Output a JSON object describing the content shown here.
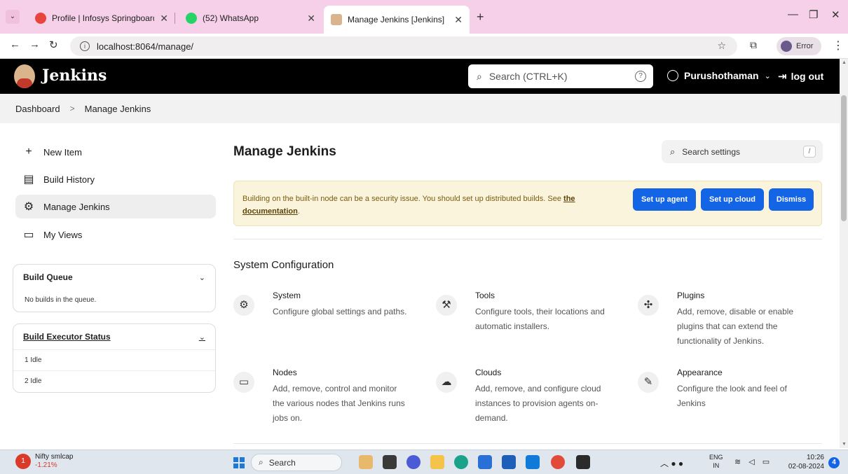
{
  "browser": {
    "tabs": [
      {
        "title": "Profile | Infosys Springboard",
        "active": false,
        "color": "#e8453c"
      },
      {
        "title": "(52) WhatsApp",
        "active": false,
        "color": "#25d366"
      },
      {
        "title": "Manage Jenkins [Jenkins]",
        "active": true,
        "color": "#d9b48c"
      }
    ],
    "url": "localhost:8064/manage/",
    "profile_label": "Error"
  },
  "header": {
    "brand": "Jenkins",
    "search_placeholder": "Search (CTRL+K)",
    "user": "Purushothaman",
    "logout": "log out"
  },
  "breadcrumb": {
    "items": [
      "Dashboard",
      "Manage Jenkins"
    ]
  },
  "sidebar": {
    "items": [
      {
        "label": "New Item",
        "icon": "plus-icon"
      },
      {
        "label": "Build History",
        "icon": "history-icon"
      },
      {
        "label": "Manage Jenkins",
        "icon": "gear-icon",
        "active": true
      },
      {
        "label": "My Views",
        "icon": "window-icon"
      }
    ],
    "build_queue": {
      "title": "Build Queue",
      "empty_text": "No builds in the queue."
    },
    "executor_status": {
      "title": "Build Executor Status",
      "rows": [
        "1  Idle",
        "2  Idle"
      ]
    }
  },
  "main": {
    "title": "Manage Jenkins",
    "settings_search_placeholder": "Search settings",
    "settings_search_shortcut": "/",
    "alert": {
      "text": "Building on the built-in node can be a security issue. You should set up distributed builds. See ",
      "link": "the documentation",
      "suffix": ".",
      "buttons": [
        "Set up agent",
        "Set up cloud",
        "Dismiss"
      ]
    },
    "section_title": "System Configuration",
    "cards": [
      {
        "title": "System",
        "desc": "Configure global settings and paths.",
        "icon": "gear-icon"
      },
      {
        "title": "Tools",
        "desc": "Configure tools, their locations and automatic installers.",
        "icon": "hammer-icon"
      },
      {
        "title": "Plugins",
        "desc": "Add, remove, disable or enable plugins that can extend the functionality of Jenkins.",
        "icon": "puzzle-icon"
      },
      {
        "title": "Nodes",
        "desc": "Add, remove, control and monitor the various nodes that Jenkins runs jobs on.",
        "icon": "monitor-icon"
      },
      {
        "title": "Clouds",
        "desc": "Add, remove, and configure cloud instances to provision agents on-demand.",
        "icon": "cloud-icon"
      },
      {
        "title": "Appearance",
        "desc": "Configure the look and feel of Jenkins",
        "icon": "brush-icon"
      }
    ]
  },
  "taskbar": {
    "widget_title": "Nifty smlcap",
    "widget_value": "-1.21%",
    "widget_badge": "1",
    "search": "Search",
    "lang_top": "ENG",
    "lang_bottom": "IN",
    "time": "10:26",
    "date": "02-08-2024",
    "notifications": "4"
  },
  "colors": {
    "accent": "#1464e6",
    "alert_bg": "#fbf4dc",
    "header_bg": "#000000"
  }
}
